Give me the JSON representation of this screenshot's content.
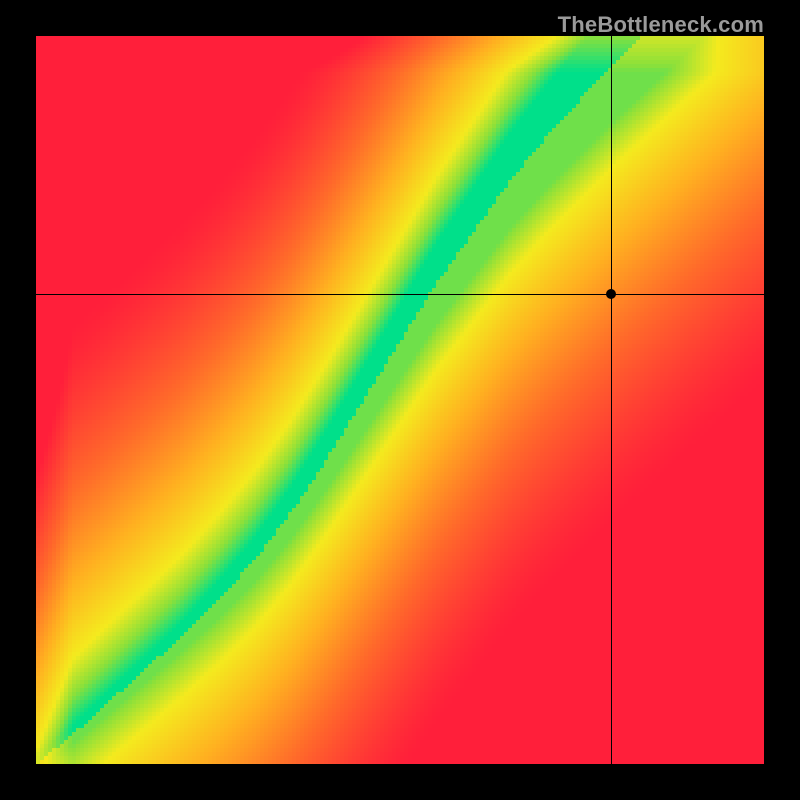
{
  "watermark": "TheBottleneck.com",
  "colors": {
    "background": "#000000",
    "heat_stops": [
      {
        "t": 0.0,
        "color": "#ff1f3a"
      },
      {
        "t": 0.3,
        "color": "#ff6a2a"
      },
      {
        "t": 0.55,
        "color": "#ffb020"
      },
      {
        "t": 0.78,
        "color": "#f4ea1e"
      },
      {
        "t": 0.9,
        "color": "#8be03a"
      },
      {
        "t": 1.0,
        "color": "#00e08a"
      }
    ]
  },
  "grid": {
    "resolution": 182,
    "pixelated": true
  },
  "crosshair": {
    "x_frac": 0.79,
    "y_frac": 0.645
  },
  "chart_data": {
    "type": "heatmap",
    "title": "",
    "xlabel": "",
    "ylabel": "",
    "x_range": [
      0,
      1
    ],
    "y_range": [
      0,
      1
    ],
    "description": "Heatmap over normalized (x,y) in [0,1]^2. Green ridge marks the region where y ≈ f(x); color encodes closeness to that ridge (1 = on-ridge, 0 = far).",
    "ridge_curve_samples": [
      {
        "x": 0.0,
        "y": 0.0
      },
      {
        "x": 0.05,
        "y": 0.04
      },
      {
        "x": 0.1,
        "y": 0.085
      },
      {
        "x": 0.15,
        "y": 0.13
      },
      {
        "x": 0.2,
        "y": 0.175
      },
      {
        "x": 0.25,
        "y": 0.225
      },
      {
        "x": 0.3,
        "y": 0.28
      },
      {
        "x": 0.35,
        "y": 0.345
      },
      {
        "x": 0.4,
        "y": 0.42
      },
      {
        "x": 0.45,
        "y": 0.5
      },
      {
        "x": 0.5,
        "y": 0.58
      },
      {
        "x": 0.55,
        "y": 0.66
      },
      {
        "x": 0.6,
        "y": 0.73
      },
      {
        "x": 0.65,
        "y": 0.8
      },
      {
        "x": 0.7,
        "y": 0.86
      },
      {
        "x": 0.75,
        "y": 0.915
      },
      {
        "x": 0.8,
        "y": 0.97
      },
      {
        "x": 0.85,
        "y": 1.02
      },
      {
        "x": 0.9,
        "y": 1.07
      },
      {
        "x": 0.95,
        "y": 1.12
      },
      {
        "x": 1.0,
        "y": 1.17
      }
    ],
    "ridge_width_samples": [
      {
        "x": 0.0,
        "w": 0.01
      },
      {
        "x": 0.2,
        "w": 0.02
      },
      {
        "x": 0.4,
        "w": 0.04
      },
      {
        "x": 0.6,
        "w": 0.06
      },
      {
        "x": 0.8,
        "w": 0.08
      },
      {
        "x": 1.0,
        "w": 0.095
      }
    ],
    "marker": {
      "x": 0.79,
      "y": 0.645
    },
    "legend": {
      "min": 0,
      "max": 1,
      "direction": "red_to_green"
    }
  }
}
